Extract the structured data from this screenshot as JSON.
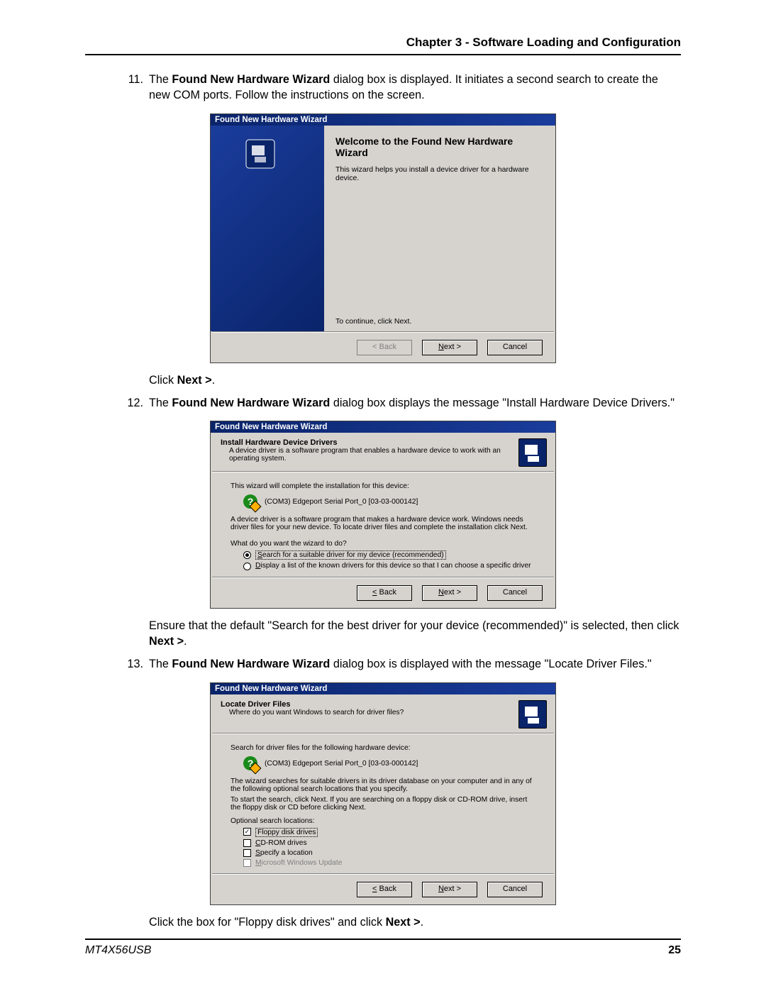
{
  "header": {
    "chapter": "Chapter 3 - Software Loading and Configuration"
  },
  "steps": {
    "s11": {
      "num": "11.",
      "text_a": "The ",
      "text_b": "Found New Hardware Wizard",
      "text_c": " dialog box is displayed. It initiates a second search to create the new COM ports. Follow the instructions on the screen.",
      "after_a": "Click ",
      "after_b": "Next >",
      "after_c": "."
    },
    "s12": {
      "num": "12.",
      "text_a": "The ",
      "text_b": "Found New Hardware Wizard",
      "text_c": " dialog box displays the message \"Install Hardware Device Drivers.\"",
      "after_a": "Ensure that the default \"Search for the best driver for your device (recommended)\" is selected, then click ",
      "after_b": "Next >",
      "after_c": "."
    },
    "s13": {
      "num": "13.",
      "text_a": "The ",
      "text_b": "Found New Hardware Wizard",
      "text_c": " dialog box is displayed with the message \"Locate Driver Files.\"",
      "after_a": "Click the box for \"Floppy disk drives\" and click ",
      "after_b": "Next >",
      "after_c": "."
    }
  },
  "dialog1": {
    "title": "Found New Hardware Wizard",
    "heading": "Welcome to the Found New Hardware Wizard",
    "desc": "This wizard helps you install a device driver for a hardware device.",
    "continue": "To continue, click Next.",
    "back": "< Back",
    "next": "Next >",
    "cancel": "Cancel"
  },
  "dialog2": {
    "title": "Found New Hardware Wizard",
    "head_title": "Install Hardware Device Drivers",
    "head_desc": "A device driver is a software program that enables a hardware device to work with an operating system.",
    "line1": "This wizard will complete the installation for this device:",
    "device": "(COM3) Edgeport Serial Port_0 [03-03-000142]",
    "para": "A device driver is a software program that makes a hardware device work. Windows needs driver files for your new device. To locate driver files and complete the installation click Next.",
    "question": "What do you want the wizard to do?",
    "opt1": "Search for a suitable driver for my device (recommended)",
    "opt2": "Display a list of the known drivers for this device so that I can choose a specific driver",
    "back": "< Back",
    "next": "Next >",
    "cancel": "Cancel"
  },
  "dialog3": {
    "title": "Found New Hardware Wizard",
    "head_title": "Locate Driver Files",
    "head_desc": "Where do you want Windows to search for driver files?",
    "line1": "Search for driver files for the following hardware device:",
    "device": "(COM3) Edgeport Serial Port_0 [03-03-000142]",
    "para1": "The wizard searches for suitable drivers in its driver database on your computer and in any of the following optional search locations that you specify.",
    "para2": "To start the search, click Next. If you are searching on a floppy disk or CD-ROM drive, insert the floppy disk or CD before clicking Next.",
    "opt_label": "Optional search locations:",
    "chk1": "Floppy disk drives",
    "chk2": "CD-ROM drives",
    "chk3": "Specify a location",
    "chk4": "Microsoft Windows Update",
    "back": "< Back",
    "next": "Next >",
    "cancel": "Cancel"
  },
  "footer": {
    "product": "MT4X56USB",
    "page": "25"
  }
}
